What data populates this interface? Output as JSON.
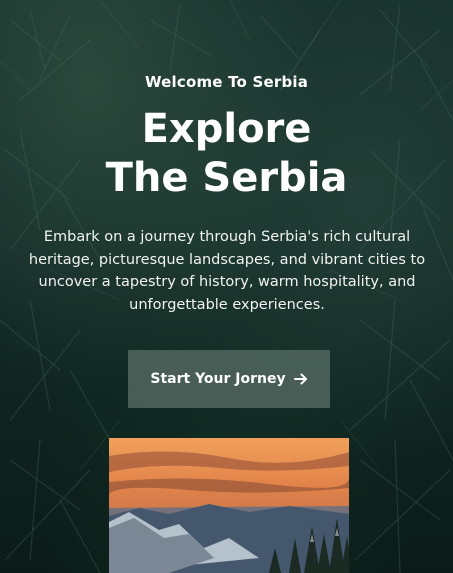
{
  "hero": {
    "eyebrow": "Welcome To Serbia",
    "title_line_1": "Explore",
    "title_line_2": "The Serbia",
    "description": "Embark on a journey through Serbia's rich cultural heritage, picturesque landscapes, and vibrant cities to uncover a tapestry of history, warm hospitality, and unforgettable experiences.",
    "cta_label": "Start Your Jorney",
    "cta_icon": "arrow-right-icon"
  },
  "colors": {
    "background": "#1a332d",
    "button": "#4e645c",
    "text": "#ffffff",
    "sky_orange": "#e8894a"
  }
}
